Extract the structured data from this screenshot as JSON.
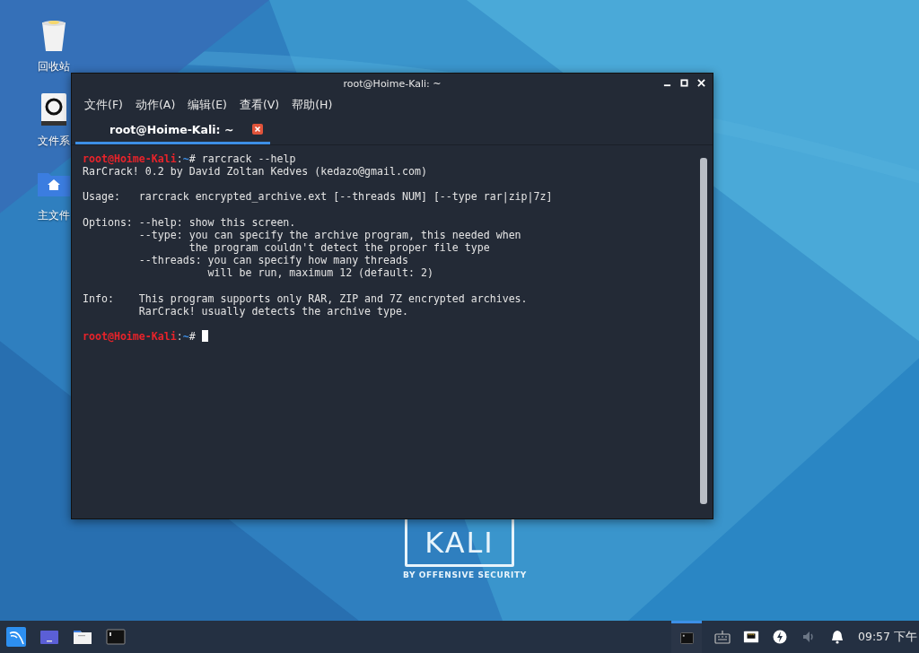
{
  "desktop": {
    "icons": [
      {
        "kind": "trash",
        "label": "回收站"
      },
      {
        "kind": "drive",
        "label": "文件系"
      },
      {
        "kind": "home",
        "label": "主文件"
      }
    ],
    "logo": {
      "wordmark": "KALI",
      "tagline": "BY OFFENSIVE SECURITY"
    }
  },
  "window": {
    "title": "root@Hoime-Kali: ~",
    "menu": [
      "文件(F)",
      "动作(A)",
      "编辑(E)",
      "查看(V)",
      "帮助(H)"
    ],
    "tabs": [
      {
        "label": "root@Hoime-Kali: ~",
        "selected": true
      }
    ],
    "terminal": [
      {
        "kind": "prompt",
        "user": "root@Hoime-Kali",
        "separator": ":",
        "path": "~",
        "symbol": "#",
        "command": "rarcrack --help",
        "cursor": false
      },
      {
        "kind": "text",
        "text": "RarCrack! 0.2 by David Zoltan Kedves (kedazo@gmail.com)"
      },
      {
        "kind": "blank"
      },
      {
        "kind": "text",
        "text": "Usage:   rarcrack encrypted_archive.ext [--threads NUM] [--type rar|zip|7z]"
      },
      {
        "kind": "blank"
      },
      {
        "kind": "text",
        "text": "Options: --help: show this screen."
      },
      {
        "kind": "text",
        "text": "         --type: you can specify the archive program, this needed when"
      },
      {
        "kind": "text",
        "text": "                 the program couldn't detect the proper file type"
      },
      {
        "kind": "text",
        "text": "         --threads: you can specify how many threads"
      },
      {
        "kind": "text",
        "text": "                    will be run, maximum 12 (default: 2)"
      },
      {
        "kind": "blank"
      },
      {
        "kind": "text",
        "text": "Info:    This program supports only RAR, ZIP and 7Z encrypted archives."
      },
      {
        "kind": "text",
        "text": "         RarCrack! usually detects the archive type."
      },
      {
        "kind": "blank"
      },
      {
        "kind": "prompt",
        "user": "root@Hoime-Kali",
        "separator": ":",
        "path": "~",
        "symbol": "#",
        "cursor": true
      }
    ]
  },
  "taskbar": {
    "launchers": [
      {
        "kind": "kali"
      },
      {
        "kind": "desktop"
      },
      {
        "kind": "files"
      },
      {
        "kind": "terminal"
      }
    ],
    "tasks": [
      {
        "kind": "terminal",
        "selected": true
      }
    ],
    "tray": [
      {
        "kind": "keyboard"
      },
      {
        "kind": "network"
      },
      {
        "kind": "power"
      },
      {
        "kind": "volume"
      },
      {
        "kind": "bell"
      }
    ],
    "clock": "09:57 下午"
  }
}
